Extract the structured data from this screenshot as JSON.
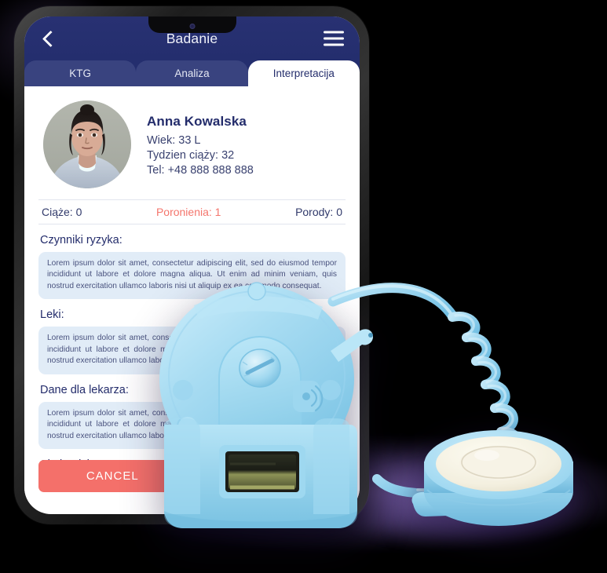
{
  "header": {
    "title": "Badanie",
    "back_icon": "chevron-left-icon",
    "menu_icon": "hamburger-menu-icon"
  },
  "tabs": [
    {
      "label": "KTG",
      "active": false
    },
    {
      "label": "Analiza",
      "active": false
    },
    {
      "label": "Interpretacija",
      "active": true
    }
  ],
  "patient": {
    "name": "Anna Kowalska",
    "age": "Wiek: 33 L",
    "week": "Tydzien ciąży: 32",
    "phone": "Tel: +48 888 888 888",
    "avatar_alt": "patient-photo"
  },
  "stats": [
    {
      "label": "Ciąże: 0",
      "highlight": false
    },
    {
      "label": "Poronienia: 1",
      "highlight": true
    },
    {
      "label": "Porody: 0",
      "highlight": false
    }
  ],
  "sections": [
    {
      "title": "Czynniki ryzyka:",
      "body": "Lorem ipsum dolor sit amet, consectetur adipiscing elit, sed do eiusmod tempor incididunt ut labore et dolore magna aliqua. Ut enim ad minim veniam, quis nostrud exercitation ullamco laboris nisi ut aliquip ex ea commodo consequat."
    },
    {
      "title": "Leki:",
      "body": "Lorem ipsum dolor sit amet, consectetur adipiscing elit, sed do eiusmod tempor incididunt ut labore et dolore magna aliqua. Ut enim ad minim veniam, quis nostrud exercitation ullamco laboris nisi ut aliquip ex ea commodo consequat."
    },
    {
      "title": "Dane dla lekarza:",
      "body": "Lorem ipsum dolor sit amet, consectetur adipiscing elit, sed do eiusmod tempor incididunt ut labore et dolore magna aliqua. Ut enim ad minim veniam, quis nostrud exercitation ullamco laboris nisi ut aliquip ex ea commodo consequat."
    }
  ],
  "fisher": {
    "title": "Skala Fishera:",
    "value": ""
  },
  "buttons": [
    {
      "label": "CANCEL"
    },
    {
      "label": ""
    }
  ],
  "colors": {
    "header_navy": "#242e6e",
    "tab_inactive": "#39437f",
    "accent_coral": "#f4706a",
    "textbox_blue": "#e1ecf7",
    "device_blue": "#a8dcf2",
    "background": "#000000",
    "glow_purple": "#7a60a6"
  },
  "device": {
    "name": "fetal-doppler-device",
    "probe_name": "doppler-probe"
  }
}
